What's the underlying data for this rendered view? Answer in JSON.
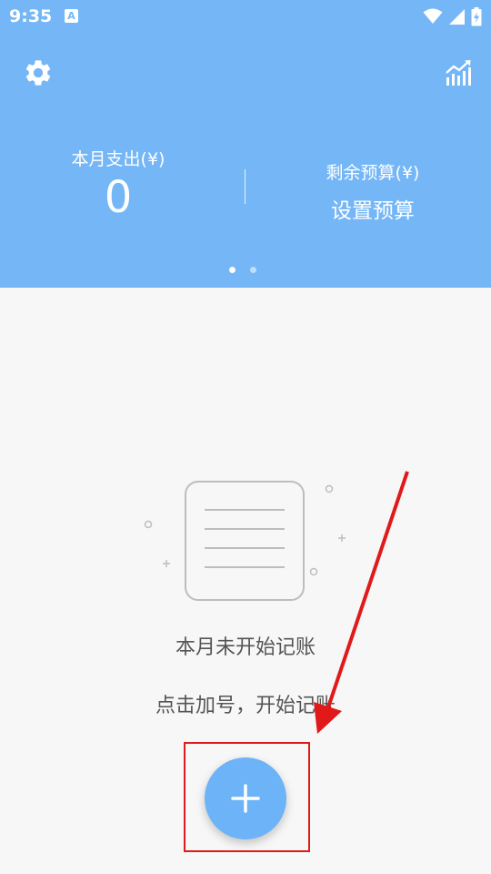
{
  "status_bar": {
    "time": "9:35",
    "notification_icon_letter": "A",
    "icons": [
      "wifi-icon",
      "cellular-signal-icon",
      "battery-charging-icon"
    ]
  },
  "toolbar": {
    "left_icon": "gear-icon",
    "right_icon": "stats-chart-icon"
  },
  "summary": {
    "expense_label": "本月支出(¥)",
    "expense_value": "0",
    "budget_label": "剩余预算(¥)",
    "budget_action": "设置预算"
  },
  "pager": {
    "count": 2,
    "active_index": 0
  },
  "empty_state": {
    "icon": "empty-notes-icon",
    "title": "本月未开始记账",
    "hint": "点击加号，开始记账"
  },
  "fab": {
    "icon": "plus-icon"
  },
  "colors": {
    "header": "#74b6f6",
    "fab": "#6db3f7",
    "annotation": "#e11919",
    "background": "#f7f7f7"
  }
}
